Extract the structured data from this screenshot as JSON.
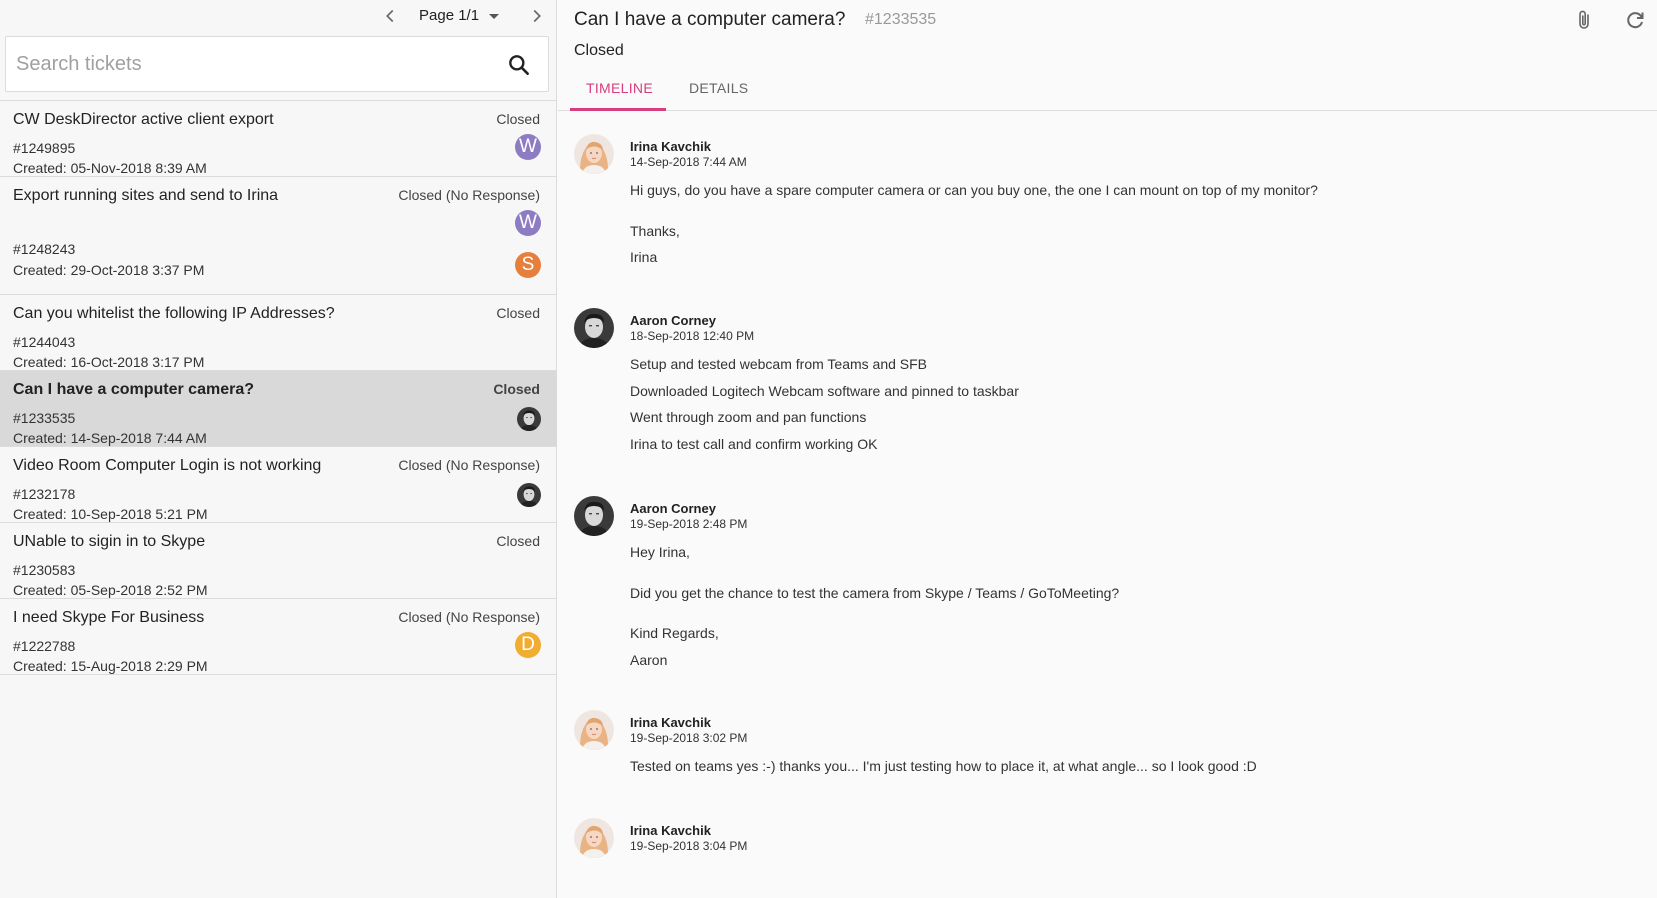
{
  "pager": {
    "label": "Page 1/1"
  },
  "search": {
    "placeholder": "Search tickets"
  },
  "tickets": [
    {
      "title": "CW DeskDirector active client export",
      "status": "Closed",
      "number": "#1249895",
      "created": "Created: 05-Nov-2018 8:39 AM",
      "avatars": [
        "W"
      ]
    },
    {
      "title": "Export running sites and send to Irina",
      "status": "Closed (No Response)",
      "number": "#1248243",
      "created": "Created: 29-Oct-2018 3:37 PM",
      "avatars": [
        "W",
        "S"
      ]
    },
    {
      "title": "Can you whitelist the following IP Addresses?",
      "status": "Closed",
      "number": "#1244043",
      "created": "Created: 16-Oct-2018 3:17 PM",
      "avatars": []
    },
    {
      "title": "Can I have a computer camera?",
      "status": "Closed",
      "number": "#1233535",
      "created": "Created: 14-Sep-2018 7:44 AM",
      "avatars": [
        "photo"
      ]
    },
    {
      "title": "Video Room Computer Login is not working",
      "status": "Closed (No Response)",
      "number": "#1232178",
      "created": "Created: 10-Sep-2018 5:21 PM",
      "avatars": [
        "photo"
      ]
    },
    {
      "title": "UNable to sigin in to Skype",
      "status": "Closed",
      "number": "#1230583",
      "created": "Created: 05-Sep-2018 2:52 PM",
      "avatars": []
    },
    {
      "title": "I need Skype For Business",
      "status": "Closed (No Response)",
      "number": "#1222788",
      "created": "Created: 15-Aug-2018 2:29 PM",
      "avatars": [
        "D"
      ]
    }
  ],
  "avatar_colors": {
    "W": "#8e7cc3",
    "S": "#e67e3c",
    "D": "#f0ad2f"
  },
  "ticket": {
    "title": "Can I have a computer camera?",
    "id": "#1233535",
    "status": "Closed"
  },
  "tabs": {
    "timeline": "TIMELINE",
    "details": "DETAILS"
  },
  "accent_color": "#d63e7e",
  "timeline": [
    {
      "author": "Irina Kavchik",
      "time": "14-Sep-2018 7:44 AM",
      "avatar": "irina",
      "lines": [
        "Hi guys, do you have a spare computer camera or can you buy one, the one I can mount on top of my monitor?",
        "",
        "Thanks,",
        "Irina"
      ]
    },
    {
      "author": "Aaron Corney",
      "time": "18-Sep-2018 12:40 PM",
      "avatar": "aaron",
      "lines": [
        "Setup and tested webcam from Teams and SFB",
        "Downloaded Logitech Webcam software and pinned to taskbar",
        "Went through zoom and pan functions",
        "Irina to test call and confirm working OK"
      ]
    },
    {
      "author": "Aaron Corney",
      "time": "19-Sep-2018 2:48 PM",
      "avatar": "aaron",
      "lines": [
        "Hey Irina,",
        "",
        "Did you get the chance to test the camera from Skype / Teams / GoToMeeting?",
        "",
        "Kind Regards,",
        "Aaron"
      ]
    },
    {
      "author": "Irina Kavchik",
      "time": "19-Sep-2018 3:02 PM",
      "avatar": "irina",
      "lines": [
        "Tested on teams yes :-) thanks you... I'm just testing how to place it, at what angle... so I look good :D"
      ]
    },
    {
      "author": "Irina Kavchik",
      "time": "19-Sep-2018 3:04 PM",
      "avatar": "irina",
      "lines": []
    }
  ]
}
